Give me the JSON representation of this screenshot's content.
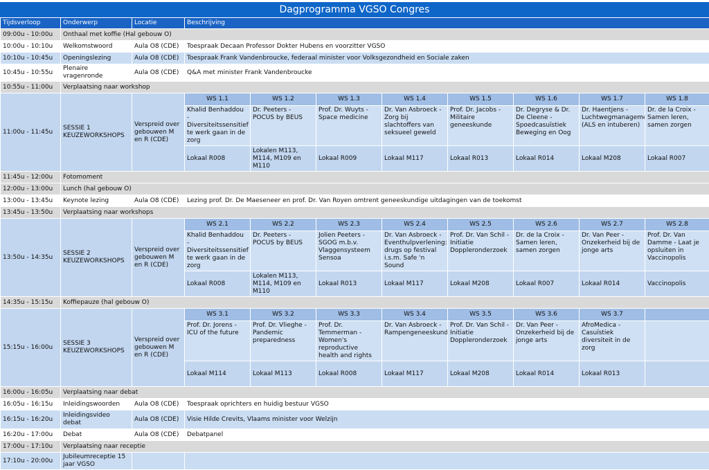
{
  "title": "Dagprogramma VGSO Congres",
  "headers": [
    "Tijdsverloop",
    "Onderwerp",
    "Locatie",
    "Beschrijving"
  ],
  "rows": {
    "r1": {
      "time": "09:00u - 10:00u",
      "subject": "Onthaal met koffie (Hal gebouw O)"
    },
    "r2": {
      "time": "10:00u - 10:10u",
      "subject": "Welkomstwoord",
      "location": "Aula O8 (CDE)",
      "description": "Toespraak Decaan Professor Dokter Hubens en voorzitter VGSO"
    },
    "r3": {
      "time": "10:10u - 10:45u",
      "subject": "Openingslezing",
      "location": "Aula O8 (CDE)",
      "description": "Toespraak Frank Vandenbroucke, federaal minister voor Volksgezondheid en Sociale zaken"
    },
    "r4": {
      "time": "10:45u - 10:55u",
      "subject": "Plenaire vragenronde",
      "location": "Aula O8 (CDE)",
      "description": "Q&A met minister Frank Vandenbroucke"
    },
    "r5": {
      "time": "10:55u - 11:00u",
      "subject": "Verplaatsing naar workshop"
    },
    "r7": {
      "time": "11:45u - 12:00u",
      "subject": "Fotomoment"
    },
    "r8": {
      "time": "12:00u - 13:00u",
      "subject": "Lunch (hal gebouw O)"
    },
    "r9": {
      "time": "13:00u - 13:45u",
      "subject": "Keynote lezing",
      "location": "Aula O8 (CDE)",
      "description": "Lezing prof. Dr. De Maeseneer en prof. Dr. Van Royen omtrent geneeskundige uitdagingen van de toekomst"
    },
    "r10": {
      "time": "13:45u - 13:50u",
      "subject": "Verplaatsing naar workshops"
    },
    "r12": {
      "time": "14:35u - 15:15u",
      "subject": "Koffiepauze (hal gebouw O)"
    },
    "r14": {
      "time": "16:00u - 16:05u",
      "subject": "Verplaatsing naar debat"
    },
    "r15": {
      "time": "16:05u - 16:15u",
      "subject": "Inleidingswoorden",
      "location": "Aula O8 (CDE)",
      "description": "Toespraak oprichters en huidig bestuur VGSO"
    },
    "r16": {
      "time": "16:15u - 16:20u",
      "subject": "Inleidingsvideo debat",
      "location": "Aula O8 (CDE)",
      "description": "Visie Hilde Crevits, Vlaams minister voor Welzijn"
    },
    "r17": {
      "time": "16:20u - 17:00u",
      "subject": "Debat",
      "location": "Aula O8 (CDE)",
      "description": "Debatpanel"
    },
    "r18": {
      "time": "17:00u - 17:10u",
      "subject": "Verplaatsing naar receptie"
    },
    "r19": {
      "time": "17:10u - 20:00u",
      "subject": "Jubileumreceptie 15 jaar VGSO"
    }
  },
  "sessions": [
    {
      "time": "11:00u - 11:45u",
      "name": "SESSIE 1 KEUZEWORKSHOPS",
      "location": "Verspreid over gebouwen M en R (CDE)",
      "workshops": [
        {
          "ws": "WS 1.1",
          "desc": "Khalid Benhaddou - Diversiteitssensitief te werk gaan in de zorg",
          "room": "Lokaal R008"
        },
        {
          "ws": "WS 1.2",
          "desc": "Dr. Peeters - POCUS by BEUS",
          "room": "Lokalen M113, M114, M109 en M110"
        },
        {
          "ws": "WS 1.3",
          "desc": "Prof. Dr. Wuyts - Space medicine",
          "room": "Lokaal R009"
        },
        {
          "ws": "WS 1.4",
          "desc": "Dr. Van Asbroeck - Zorg bij slachtoffers van seksueel geweld",
          "room": "Lokaal M117"
        },
        {
          "ws": "WS 1.5",
          "desc": "Prof. Dr. Jacobs - Militaire geneeskunde",
          "room": "Lokaal R013"
        },
        {
          "ws": "WS 1.6",
          "desc": "Dr. Degryse & Dr. De Cleene - Spoedcasuïstiek Beweging en Oog",
          "room": "Lokaal R014"
        },
        {
          "ws": "WS 1.7",
          "desc": "Dr. Haentjens - Luchtwegmanagement (ALS en intuberen)",
          "room": "Lokaal M208"
        },
        {
          "ws": "WS 1.8",
          "desc": "Dr. de la Croix - Samen leren, samen zorgen",
          "room": "Lokaal R007"
        }
      ]
    },
    {
      "time": "13:50u - 14:35u",
      "name": "SESSIE 2 KEUZEWORKSHOPS",
      "location": "Verspreid over gebouwen M en R (CDE)",
      "workshops": [
        {
          "ws": "WS 2.1",
          "desc": "Khalid Benhaddou - Diversiteitssensitief te werk gaan in de zorg",
          "room": "Lokaal R008"
        },
        {
          "ws": "WS 2.2",
          "desc": "Dr. Peeters - POCUS by BEUS",
          "room": "Lokalen M113, M114, M109 en M110"
        },
        {
          "ws": "WS 2.3",
          "desc": "Jolien Peeters - SGOG m.b.v. Vlaggensysteem Sensoa",
          "room": "Lokaal R013"
        },
        {
          "ws": "WS 2.4",
          "desc": "Dr. Van Asbroeck - Eventhulpverlening: drugs op festival i.s.m. Safe 'n Sound",
          "room": "Lokaal M117"
        },
        {
          "ws": "WS 2.5",
          "desc": "Prof. Dr. Van Schil - Initiatie Doppleronderzoek",
          "room": "Lokaal M208"
        },
        {
          "ws": "WS 2.6",
          "desc": "Dr. de la Croix - Samen leren, samen zorgen",
          "room": "Lokaal R007"
        },
        {
          "ws": "WS 2.7",
          "desc": "Dr. Van Peer - Onzekerheid bij de jonge arts",
          "room": "Lokaal R014"
        },
        {
          "ws": "WS 2.8",
          "desc": "Prof. Dr. Van Damme - Laat je opsluiten in Vaccinopolis",
          "room": "Vaccinopolis"
        }
      ]
    },
    {
      "time": "15:15u - 16:00u",
      "name": "SESSIE 3 KEUZEWORKSHOPS",
      "location": "Verspreid over gebouwen M en R (CDE)",
      "workshops": [
        {
          "ws": "WS 3.1",
          "desc": "Prof. Dr. Jorens - ICU of the future",
          "room": "Lokaal M114"
        },
        {
          "ws": "WS 3.2",
          "desc": "Prof. Dr. Vlieghe - Pandemic preparedness",
          "room": "Lokaal M113"
        },
        {
          "ws": "WS 3.3",
          "desc": "Prof. Dr. Temmerman - Women's reproductive health and rights",
          "room": "Lokaal R008"
        },
        {
          "ws": "WS 3.4",
          "desc": "Dr. Van Asbroeck - Rampengeneeskunde",
          "room": "Lokaal M117"
        },
        {
          "ws": "WS 3.5",
          "desc": "Prof. Dr. Van Schil - Initiatie Doppleronderzoek",
          "room": "Lokaal M208"
        },
        {
          "ws": "WS 3.6",
          "desc": "Dr. Van Peer - Onzekerheid bij de jonge arts",
          "room": "Lokaal R014"
        },
        {
          "ws": "WS 3.7",
          "desc": "AfroMedica - Casuïstiek diversiteit in de zorg",
          "room": "Lokaal R013"
        },
        {
          "ws": "",
          "desc": "",
          "room": ""
        }
      ]
    }
  ]
}
